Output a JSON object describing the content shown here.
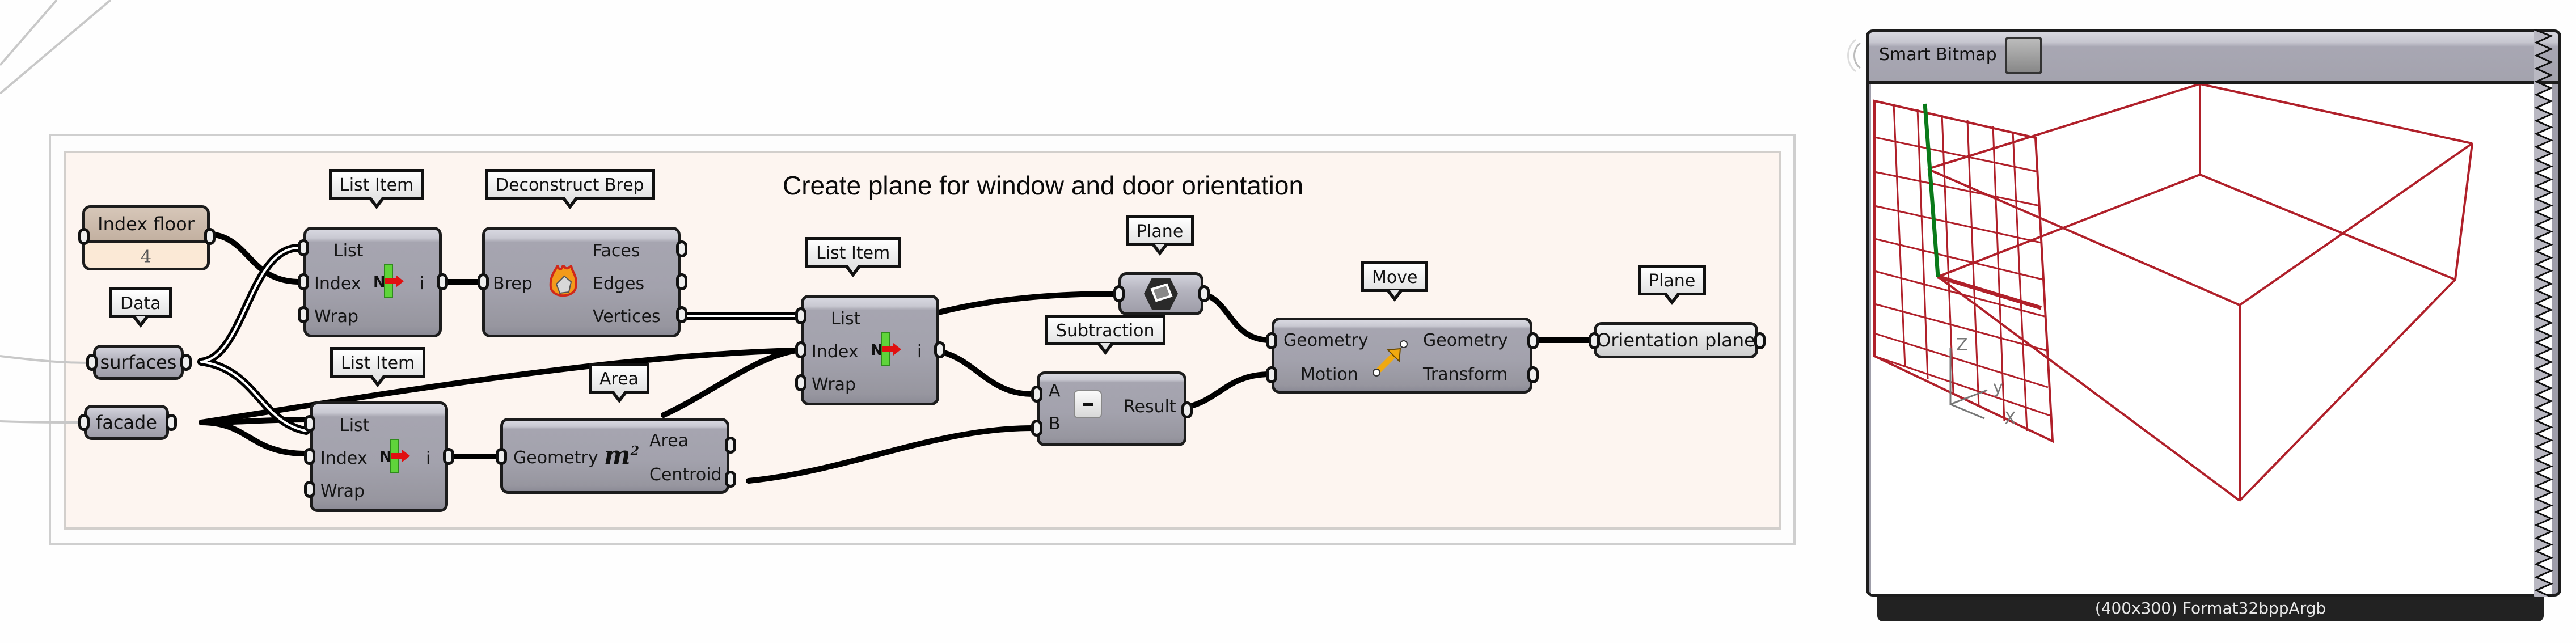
{
  "canvas": {
    "group_title": "Create plane for window and door orientation",
    "colors": {
      "group_fill": "#fdf5f0",
      "component_fill": "#a3a2ad",
      "wire": "#000000",
      "slider_fill": "#fbe9d6",
      "preview_geometry": "#b0202a",
      "axis_green": "#0a7a1a"
    }
  },
  "slider": {
    "label": "Index floor",
    "value": "4",
    "tag": null
  },
  "params": {
    "surfaces": {
      "label": "surfaces",
      "tag": "Data"
    },
    "facade": {
      "label": "facade"
    },
    "orientation_plane": {
      "label": "Orientation plane",
      "tag": "Plane"
    },
    "plane_icon_param": {
      "tag": "Plane",
      "icon": "plane-icon"
    }
  },
  "components": {
    "list_item_1": {
      "tag": "List Item",
      "inputs": [
        "List",
        "Index",
        "Wrap"
      ],
      "outputs": [
        "i"
      ],
      "icon": "list-item-icon",
      "icon_letter": "N"
    },
    "list_item_2": {
      "tag": "List Item",
      "inputs": [
        "List",
        "Index",
        "Wrap"
      ],
      "outputs": [
        "i"
      ],
      "icon": "list-item-icon",
      "icon_letter": "N"
    },
    "list_item_3": {
      "tag": "List Item",
      "inputs": [
        "List",
        "Index",
        "Wrap"
      ],
      "outputs": [
        "i"
      ],
      "icon": "list-item-icon",
      "icon_letter": "N"
    },
    "deconstruct_brep": {
      "tag": "Deconstruct Brep",
      "inputs": [
        "Brep"
      ],
      "outputs": [
        "Faces",
        "Edges",
        "Vertices"
      ],
      "icon": "deconstruct-brep-icon"
    },
    "area": {
      "tag": "Area",
      "inputs": [
        "Geometry"
      ],
      "outputs": [
        "Area",
        "Centroid"
      ],
      "icon": "area-m2-icon",
      "icon_text": "m",
      "icon_sup": "2"
    },
    "subtraction": {
      "tag": "Subtraction",
      "inputs": [
        "A",
        "B"
      ],
      "outputs": [
        "Result"
      ],
      "icon": "minus-icon",
      "icon_text": "-"
    },
    "move": {
      "tag": "Move",
      "inputs": [
        "Geometry",
        "Motion"
      ],
      "outputs": [
        "Geometry",
        "Transform"
      ],
      "icon": "move-arrow-icon"
    }
  },
  "smart_bitmap": {
    "title": "Smart Bitmap",
    "footer": "(400x300) Format32bppArgb",
    "axes": {
      "x": "X",
      "y": "y",
      "z": "Z"
    }
  }
}
